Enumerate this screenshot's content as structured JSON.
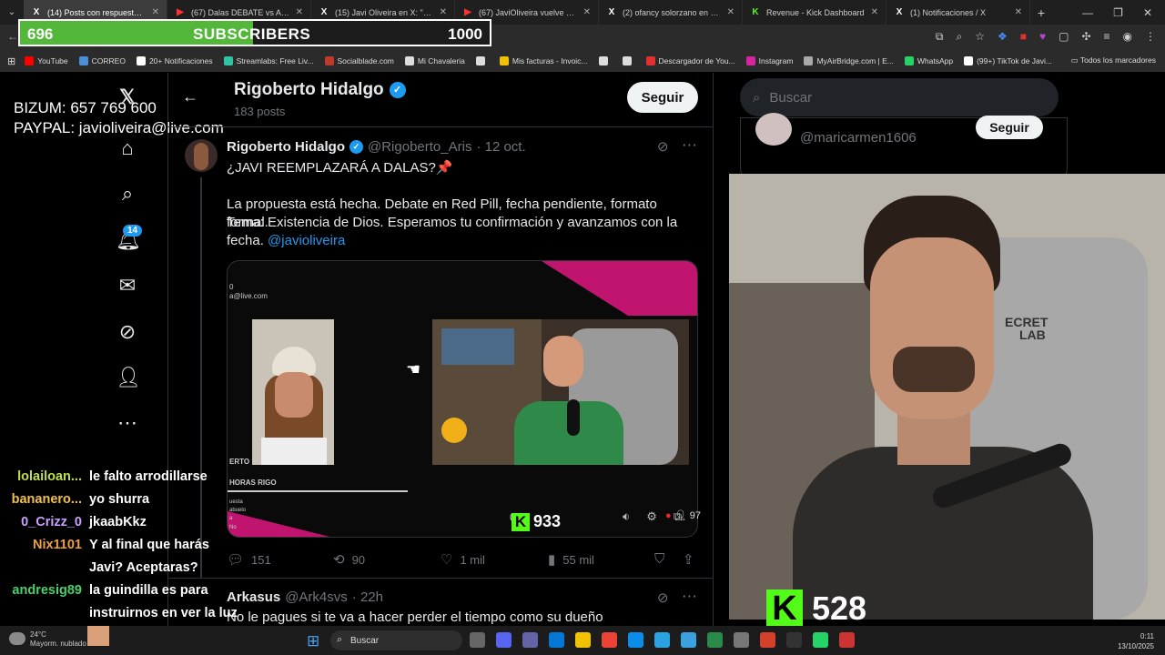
{
  "browser": {
    "tabs": [
      {
        "icon": "X",
        "label": "(14) Posts con respuestas de",
        "active": true
      },
      {
        "icon": "▶",
        "label": "(67) Dalas DEBATE vs Aleluyo h",
        "active": false
      },
      {
        "icon": "X",
        "label": "(15) Javi Oliveira en X: \"Delox s",
        "active": false
      },
      {
        "icon": "▶",
        "label": "(67) JaviOliveira vuelve a atacar",
        "active": false
      },
      {
        "icon": "X",
        "label": "(2) ofancy solorzano en X: \"Gui",
        "active": false
      },
      {
        "icon": "K",
        "label": "Revenue - Kick Dashboard",
        "active": false
      },
      {
        "icon": "X",
        "label": "(1) Notificaciones / X",
        "active": false
      }
    ],
    "new_tab": "+",
    "bookmarks": [
      {
        "label": "YouTube",
        "color": "#ff0000"
      },
      {
        "label": "CORREO",
        "color": "#4a90d9"
      },
      {
        "label": "20+ Notificaciones",
        "color": "#ffffff"
      },
      {
        "label": "Streamlabs: Free Liv...",
        "color": "#31c3a2"
      },
      {
        "label": "Socialblade.com",
        "color": "#c0392b"
      },
      {
        "label": "Mi Chavaleria",
        "color": "#dddddd"
      },
      {
        "label": "",
        "color": "#dddddd"
      },
      {
        "label": "Mis facturas - Invoic...",
        "color": "#f2c200"
      },
      {
        "label": "",
        "color": "#dddddd"
      },
      {
        "label": "",
        "color": "#dddddd"
      },
      {
        "label": "Descargador de You...",
        "color": "#e03030"
      },
      {
        "label": "Instagram",
        "color": "#d6249f"
      },
      {
        "label": "MyAirBridge.com | E...",
        "color": "#aaaaaa"
      },
      {
        "label": "WhatsApp",
        "color": "#25d366"
      },
      {
        "label": "(99+) TikTok de Javi...",
        "color": "#ffffff"
      }
    ],
    "all_bookmarks": "Todos los marcadores"
  },
  "overlay": {
    "subscribers_count": "696",
    "subscribers_label": "SUBSCRIBERS",
    "subscribers_goal": "1000",
    "subscribers_progress": 0.696,
    "donate_line1": "BIZUM: 657 769 600",
    "donate_line2": "PAYPAL: javioliveira@live.com",
    "kick_count_small": "933",
    "kick_count_large": "528",
    "kick_icon": "K",
    "kick_color": "#53fc18"
  },
  "nav": {
    "notifications_badge": "14"
  },
  "profile": {
    "name": "Rigoberto Hidalgo",
    "posts": "183 posts",
    "follow_label": "Seguir"
  },
  "tweet": {
    "name": "Rigoberto Hidalgo",
    "handle": "@Rigoberto_Aris",
    "date": "· 12 oct.",
    "line1": "¿JAVI REEMPLAZARÁ A DALAS?📌",
    "line2": "La propuesta está hecha. Debate en Red Pill, fecha pendiente, formato formal.",
    "line3": "Tema: Existencia de Dios. Esperamos tu confirmación y avanzamos con la",
    "line4_text": "fecha.",
    "line4_mention": "@javioliveira",
    "media_email": "a@live.com",
    "media_top_small": "0",
    "media_side1": "ERTO",
    "media_side2": "HORAS RIGO",
    "media_side3": "uesta",
    "media_side4": "abuelo",
    "media_side5": "a",
    "media_side6": "No",
    "video_time": "0:2",
    "video_viewers": "97",
    "replies": "151",
    "reposts": "90",
    "likes": "1 mil",
    "views": "55 mil"
  },
  "reply": {
    "name": "Arkasus",
    "handle": "@Ark4svs",
    "date": "· 22h",
    "text": "No le pagues si te va a hacer perder el tiempo como su dueño"
  },
  "sidebar": {
    "search_placeholder": "Buscar",
    "suggest_handle": "@maricarmen1606",
    "suggest_follow": "Seguir"
  },
  "webcam": {
    "brand_line1": "ECRET",
    "brand_line2": "LAB"
  },
  "chat": [
    {
      "user": "lolailoan...",
      "text": "le falto arrodillarse",
      "color": "#bfe04a"
    },
    {
      "user": "bananero...",
      "text": "yo shurra",
      "color": "#f2c14a"
    },
    {
      "user": "0_Crizz_0",
      "text": "jkaabKkz",
      "color": "#c9a0ff"
    },
    {
      "user": "Nix1101",
      "text": "Y al final que harás",
      "color": "#f2a03a"
    },
    {
      "user": "",
      "text": "Javi? Aceptaras?",
      "color": "#f2a03a"
    },
    {
      "user": "andresig89",
      "text": "la guindilla es para",
      "color": "#4ad06a"
    },
    {
      "user": "",
      "text": "instruirnos en ver la luz",
      "color": "#4ad06a"
    }
  ],
  "taskbar": {
    "temp": "24°C",
    "weather": "Mayorm. nublado",
    "search": "Buscar",
    "time": "0:11",
    "date": "13/10/2025"
  }
}
